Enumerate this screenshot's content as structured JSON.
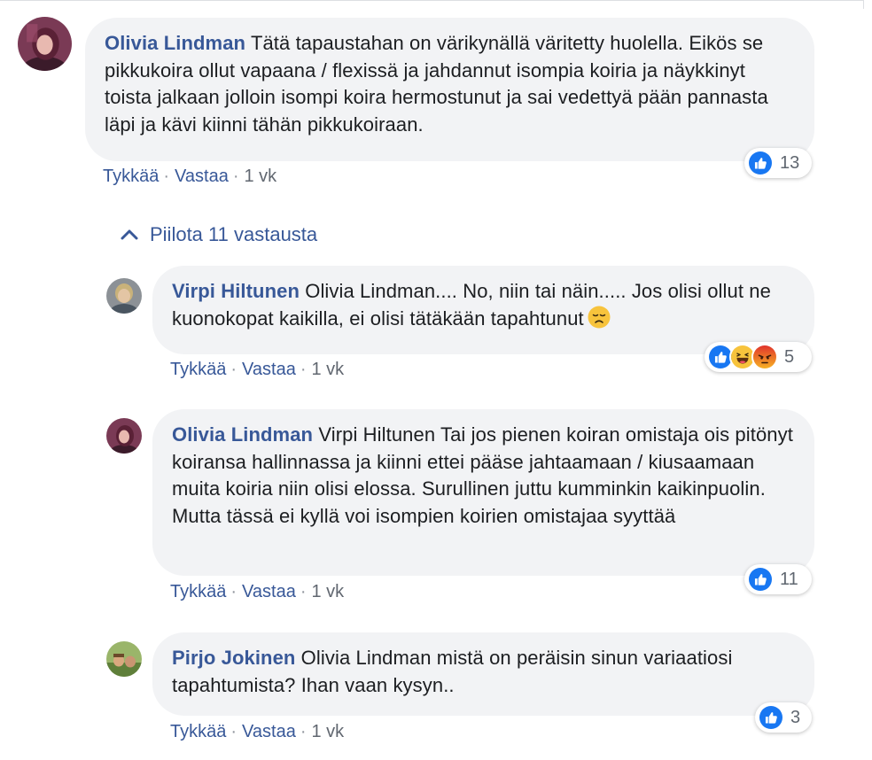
{
  "comments": [
    {
      "author": "Olivia Lindman",
      "text": "Tätä tapaustahan on värikynällä väritetty huolella. Eikös se pikkukoira ollut vapaana / flexissä ja jahdannut isompia koiria ja näykkinyt toista jalkaan jolloin isompi koira hermostunut ja sai vedettyä pään pannasta läpi ja kävi kiinni tähän pikkukoiraan.",
      "like": "Tykkää",
      "reply": "Vastaa",
      "time": "1 vk",
      "reactions": [
        "like"
      ],
      "count": "13"
    },
    {
      "author": "Virpi Hiltunen",
      "text": "Olivia Lindman.... No, niin tai näin..... Jos olisi ollut ne kuonokopat kaikilla, ei olisi tätäkään tapahtunut",
      "emoji": "disappointed-face",
      "like": "Tykkää",
      "reply": "Vastaa",
      "time": "1 vk",
      "reactions": [
        "like",
        "haha",
        "angry"
      ],
      "count": "5"
    },
    {
      "author": "Olivia Lindman",
      "text": "Virpi Hiltunen Tai jos pienen koiran omistaja ois pitönyt koiransa hallinnassa ja kiinni ettei pääse jahtaamaan / kiusaamaan muita koiria niin olisi elossa. Surullinen juttu kumminkin kaikinpuolin. Mutta tässä ei kyllä voi isompien koirien omistajaa syyttää",
      "like": "Tykkää",
      "reply": "Vastaa",
      "time": "1 vk",
      "reactions": [
        "like"
      ],
      "count": "11"
    },
    {
      "author": "Pirjo Jokinen",
      "text": "Olivia Lindman mistä on peräisin sinun variaatiosi tapahtumista? Ihan vaan kysyn..",
      "like": "Tykkää",
      "reply": "Vastaa",
      "time": "1 vk",
      "reactions": [
        "like"
      ],
      "count": "3"
    }
  ],
  "replies_toggle": {
    "label": "Piilota 11 vastausta",
    "icon": "chevron-up-icon"
  },
  "colors": {
    "link": "#385898",
    "bubble": "#f2f3f5",
    "text": "#1c1e21",
    "like_blue": "#1877f2",
    "haha_yellow": "#f7c33c",
    "angry_red": "#e9710f"
  }
}
